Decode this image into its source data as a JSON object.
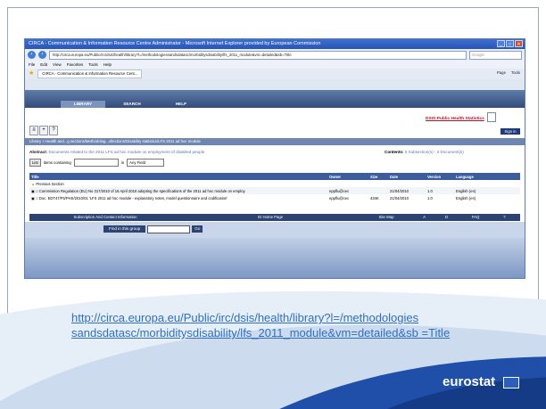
{
  "window": {
    "title": "CIRCA - Communication & Information Resource Centre Administrator - Microsoft Internet Explorer provided by European Commission",
    "url": "http://circa.europa.eu/Public/irc/dsis/health/library?l=/methodologiessandsdatasc/morbiditysdisability/lfs_2011_module&vm=detailed&sb=Title",
    "search_placeholder": "Google",
    "menu": [
      "File",
      "Edit",
      "View",
      "Favorites",
      "Tools",
      "Help"
    ],
    "tab_label": "CIRCA - Communication & Information Resource Cent...",
    "tools": [
      "Page",
      "Tools"
    ]
  },
  "page": {
    "nav_tabs": [
      "LIBRARY",
      "SEARCH",
      "HELP"
    ],
    "group_link": "DSIS:Public Health Statistics",
    "sign_in": "Sign in",
    "breadcrumb": "Library > Health and...g sections/Methodolog...ollections/Disability statistics/LFS 2011 ad hoc module",
    "abstract_label": "Abstract:",
    "abstract_text": "Documents related to the 2011 LFS ad hoc module on employment of disabled people",
    "contents_label": "Contents:",
    "contents_text": "0 Subsection(s) - 2 Document(s)",
    "list_button": "List",
    "items_containing": "items containing",
    "in_label": "in",
    "field_select": "Any Field",
    "table": {
      "headers": [
        "Title",
        "Owner",
        "Size",
        "Date",
        "Version",
        "Language"
      ],
      "owner_header_prefix": "Owner",
      "rows": [
        {
          "title": "Previous Section",
          "owner": "",
          "size": "",
          "date": "",
          "version": "",
          "language": ""
        },
        {
          "title": "Commission Regulation (EU) No 317/2010 of 16 April 2010 adopting the specifications of the 2011 ad hoc module on employ",
          "owner": "eppflu@cec",
          "size": "",
          "date": "21/04/2010",
          "version": "1.0",
          "language": "English (en)"
        },
        {
          "title": "Doc. EDT47/F5/PHS/2010/01 'LFS 2011 ad hoc module - explanatory notes, model questionnaire and codification'",
          "owner": "eppflu@cec",
          "size": "434K",
          "date": "21/04/2010",
          "version": "1.0",
          "language": "English (en)"
        }
      ]
    },
    "footer_links": [
      "Subscription And Contact Information",
      "IG Home Page",
      "Site Map",
      "A",
      "D",
      "FAQ",
      "?"
    ],
    "find_label": "Find in this group",
    "go_label": "Go"
  },
  "slide": {
    "link_text": "http://circa.europa.eu/Public/irc/dsis/health/library?l=/methodologies sandsdatasc/morbiditysdisability/lfs_2011_module&vm=detailed&sb =Title",
    "logo": "eurostat",
    "colors": {
      "accent": "#2f6fc4",
      "navy": "#2d4473",
      "brand_blue": "#1f4fa8"
    }
  }
}
